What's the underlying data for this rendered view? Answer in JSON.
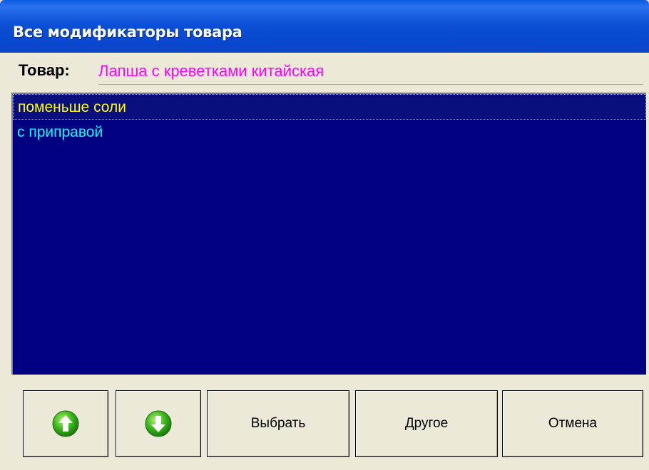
{
  "window": {
    "title": "Все модификаторы товара"
  },
  "product": {
    "label": "Товар:",
    "value": "Лапша с креветками китайская"
  },
  "modifiers": [
    {
      "label": "поменьше соли",
      "selected": true,
      "color": "#ffff00"
    },
    {
      "label": "с приправой",
      "selected": false,
      "color": "#00ffff"
    }
  ],
  "list_background": "#000080",
  "buttons": {
    "up_icon": "arrow-up-icon",
    "down_icon": "arrow-down-icon",
    "select_label": "Выбрать",
    "other_label": "Другое",
    "cancel_label": "Отмена"
  }
}
